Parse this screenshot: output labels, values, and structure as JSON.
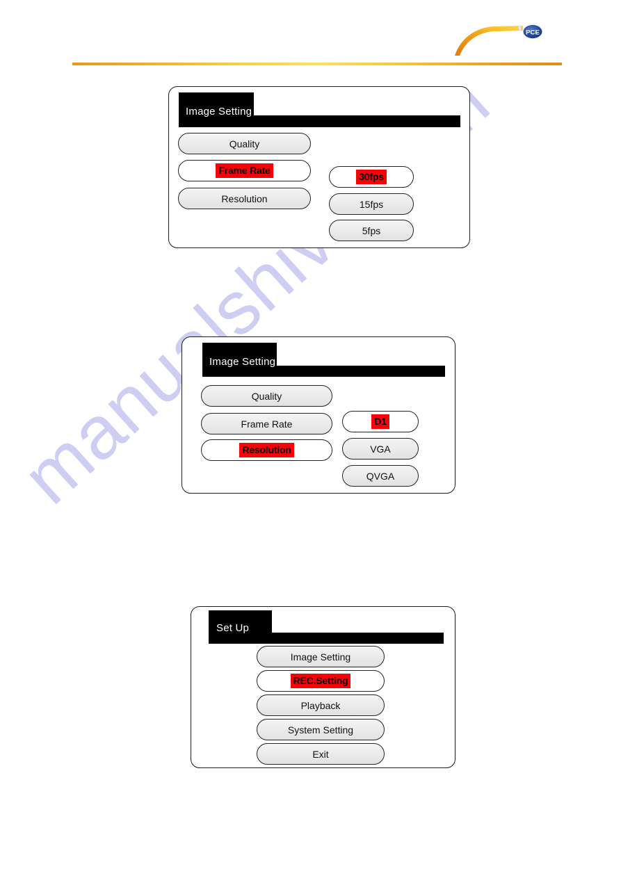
{
  "header": {
    "logo_name": "PCE",
    "logo_text": "PCE",
    "brand_color": "#1a3f8f",
    "accent_color": "#edab23"
  },
  "watermark": {
    "text": "manualshive.com",
    "color": "#ccccf2"
  },
  "panels": [
    {
      "id": "image-setting-frame-rate",
      "title": "Image Setting",
      "menu": [
        {
          "label": "Quality",
          "selected": false
        },
        {
          "label": "Frame Rate",
          "selected": true
        },
        {
          "label": "Resolution",
          "selected": false
        }
      ],
      "options": [
        {
          "label": "30fps",
          "selected": true
        },
        {
          "label": "15fps",
          "selected": false
        },
        {
          "label": "5fps",
          "selected": false
        }
      ]
    },
    {
      "id": "image-setting-resolution",
      "title": "Image Setting",
      "menu": [
        {
          "label": "Quality",
          "selected": false
        },
        {
          "label": "Frame Rate",
          "selected": false
        },
        {
          "label": "Resolution",
          "selected": true
        }
      ],
      "options": [
        {
          "label": "D1",
          "selected": true
        },
        {
          "label": "VGA",
          "selected": false
        },
        {
          "label": "QVGA",
          "selected": false
        }
      ]
    },
    {
      "id": "set-up",
      "title": "Set Up",
      "menu": [
        {
          "label": "Image Setting",
          "selected": false
        },
        {
          "label": "REC.Setting",
          "selected": true
        },
        {
          "label": "Playback",
          "selected": false
        },
        {
          "label": "System Setting",
          "selected": false
        },
        {
          "label": "Exit",
          "selected": false
        }
      ],
      "options": []
    }
  ]
}
